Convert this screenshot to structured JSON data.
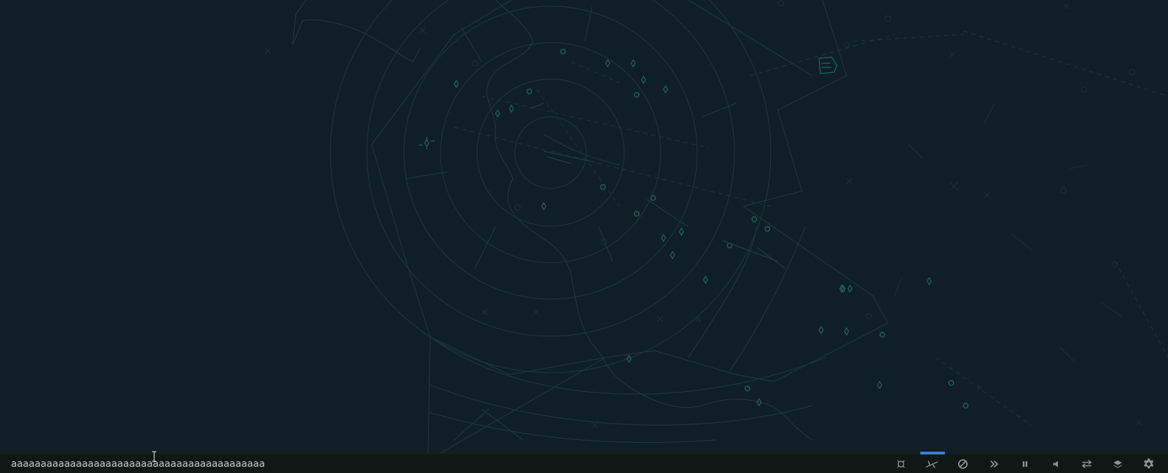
{
  "command_bar": {
    "value": "aaaaaaaaaaaaaaaaaaaaaaaaaaaaaaaaaaaaaaaaaaa",
    "placeholder": ""
  },
  "toolbar": {
    "buttons": [
      {
        "id": "airport",
        "icon": "airport-icon"
      },
      {
        "id": "aircraft",
        "icon": "aircraft-icon",
        "active": true
      },
      {
        "id": "restrict",
        "icon": "no-entry-icon"
      },
      {
        "id": "fast-forward",
        "icon": "fast-forward-icon"
      },
      {
        "id": "pause",
        "icon": "pause-icon"
      },
      {
        "id": "sound",
        "icon": "speaker-icon"
      },
      {
        "id": "swap",
        "icon": "swap-arrows-icon"
      },
      {
        "id": "layers",
        "icon": "layers-icon"
      },
      {
        "id": "settings",
        "icon": "gear-icon"
      }
    ]
  },
  "colors": {
    "background": "#0f1f25",
    "map_lines": "#21343b",
    "fix_markers": "#1f6b68",
    "toolbar_bg": "#101815",
    "active_indicator": "#3b7fd6"
  }
}
